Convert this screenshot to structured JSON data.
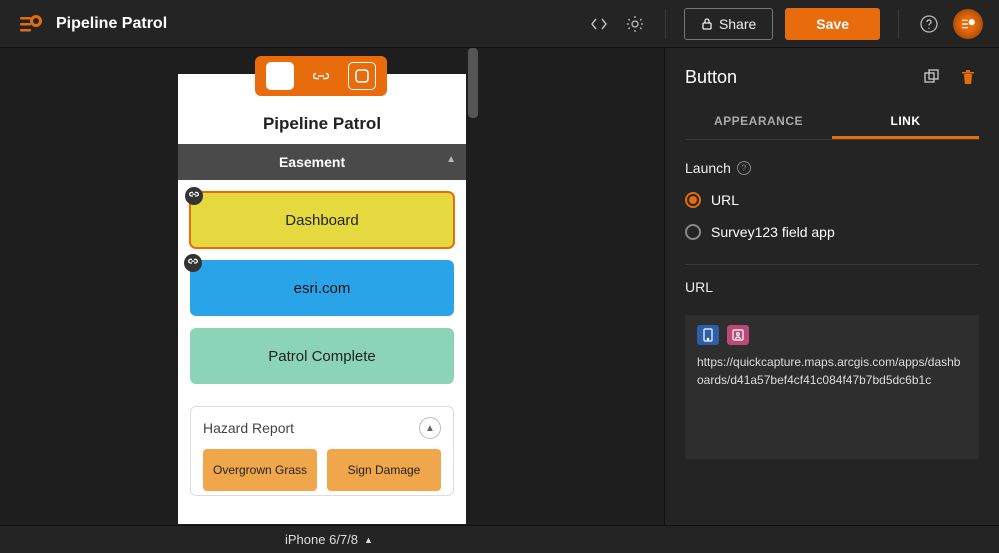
{
  "header": {
    "project_title": "Pipeline Patrol",
    "share_label": "Share",
    "save_label": "Save"
  },
  "canvas": {
    "device_title": "Pipeline Patrol",
    "section1_header": "Easement",
    "tiles": {
      "dashboard": "Dashboard",
      "esri": "esri.com",
      "complete": "Patrol Complete"
    },
    "hazard": {
      "title": "Hazard Report",
      "left": "Overgrown Grass",
      "right": "Sign Damage"
    }
  },
  "side": {
    "title": "Button",
    "tabs": {
      "appearance": "APPEARANCE",
      "link": "LINK"
    },
    "launch_label": "Launch",
    "radio_url": "URL",
    "radio_survey": "Survey123 field app",
    "url_label": "URL",
    "url_value": "https://quickcapture.maps.arcgis.com/apps/dashboards/d41a57bef4cf41c084f47b7bd5dc6b1c"
  },
  "footer": {
    "device_label": "iPhone 6/7/8"
  }
}
